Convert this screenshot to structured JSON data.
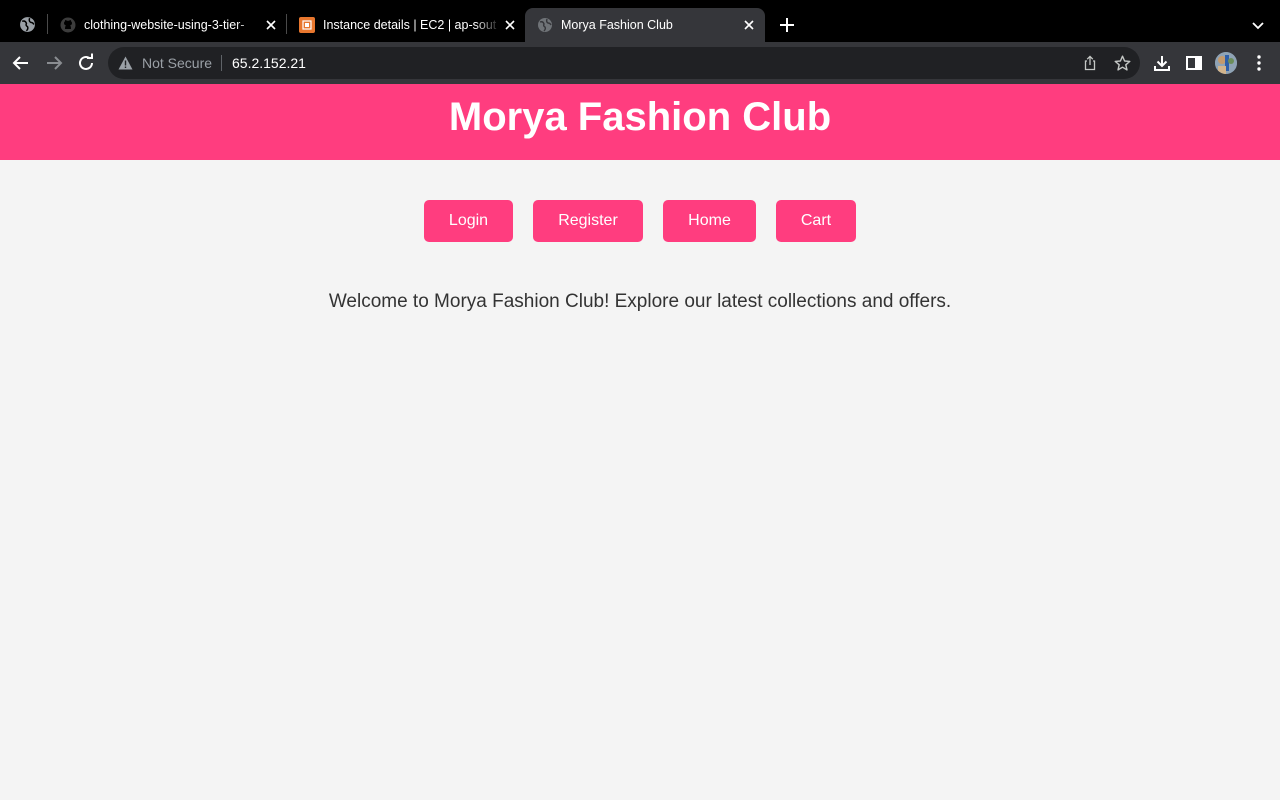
{
  "browser": {
    "tabs": [
      {
        "title": "clothing-website-using-3-tier-",
        "favicon": "github-icon",
        "active": false
      },
      {
        "title": "Instance details | EC2 | ap-sout",
        "favicon": "aws-ec2-icon",
        "active": false
      },
      {
        "title": "Morya Fashion Club",
        "favicon": "globe-icon",
        "active": true
      }
    ],
    "security_label": "Not Secure",
    "url": "65.2.152.21",
    "colors": {
      "tabstrip": "#000000",
      "toolbar": "#35363a",
      "omnibox": "#202124"
    }
  },
  "page": {
    "header": {
      "title": "Morya Fashion Club"
    },
    "nav": {
      "login": "Login",
      "register": "Register",
      "home": "Home",
      "cart": "Cart"
    },
    "welcome": "Welcome to Morya Fashion Club! Explore our latest collections and offers.",
    "colors": {
      "brand": "#ff3d7f",
      "background": "#f4f4f4",
      "text": "#333333"
    }
  }
}
